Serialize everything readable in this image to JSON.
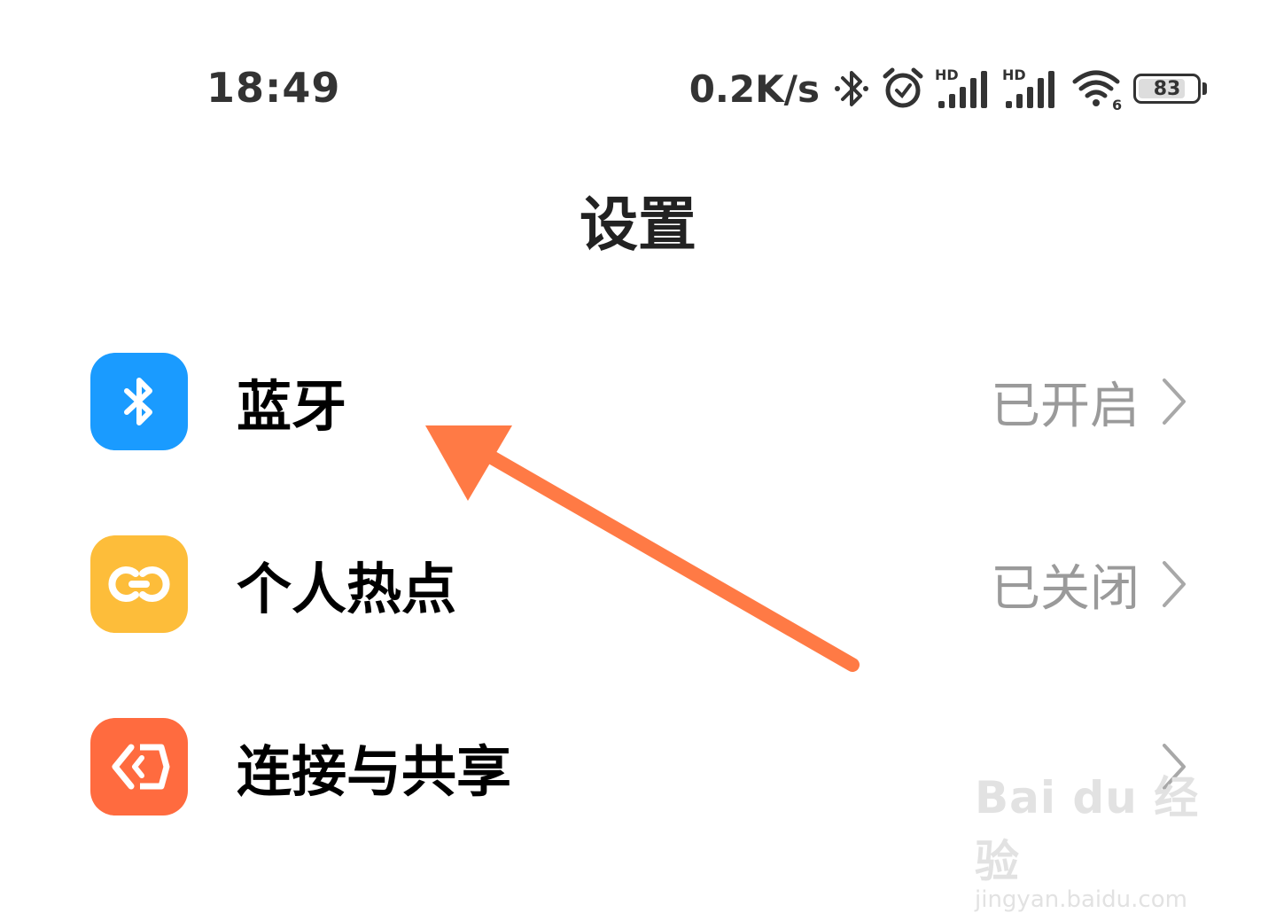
{
  "status_bar": {
    "time": "18:49",
    "net_speed": "0.2K/s",
    "signal1_label": "HD",
    "signal2_label": "HD",
    "wifi_label": "6",
    "battery_level": "83",
    "battery_percent": 83,
    "icons": [
      "bluetooth-icon",
      "alarm-icon",
      "signal-icon",
      "signal-icon",
      "wifi-icon",
      "battery-icon"
    ]
  },
  "page": {
    "title": "设置"
  },
  "settings": [
    {
      "label": "蓝牙",
      "status": "已开启",
      "icon": "bluetooth-icon",
      "icon_color": "#1a9bff"
    },
    {
      "label": "个人热点",
      "status": "已关闭",
      "icon": "hotspot-icon",
      "icon_color": "#fdbd3a"
    },
    {
      "label": "连接与共享",
      "status": "",
      "icon": "connection-share-icon",
      "icon_color": "#ff6b3f"
    }
  ],
  "annotation": {
    "color": "#ff7a45"
  },
  "watermark": {
    "brand": "Bai du 经验",
    "url": "jingyan.baidu.com"
  }
}
